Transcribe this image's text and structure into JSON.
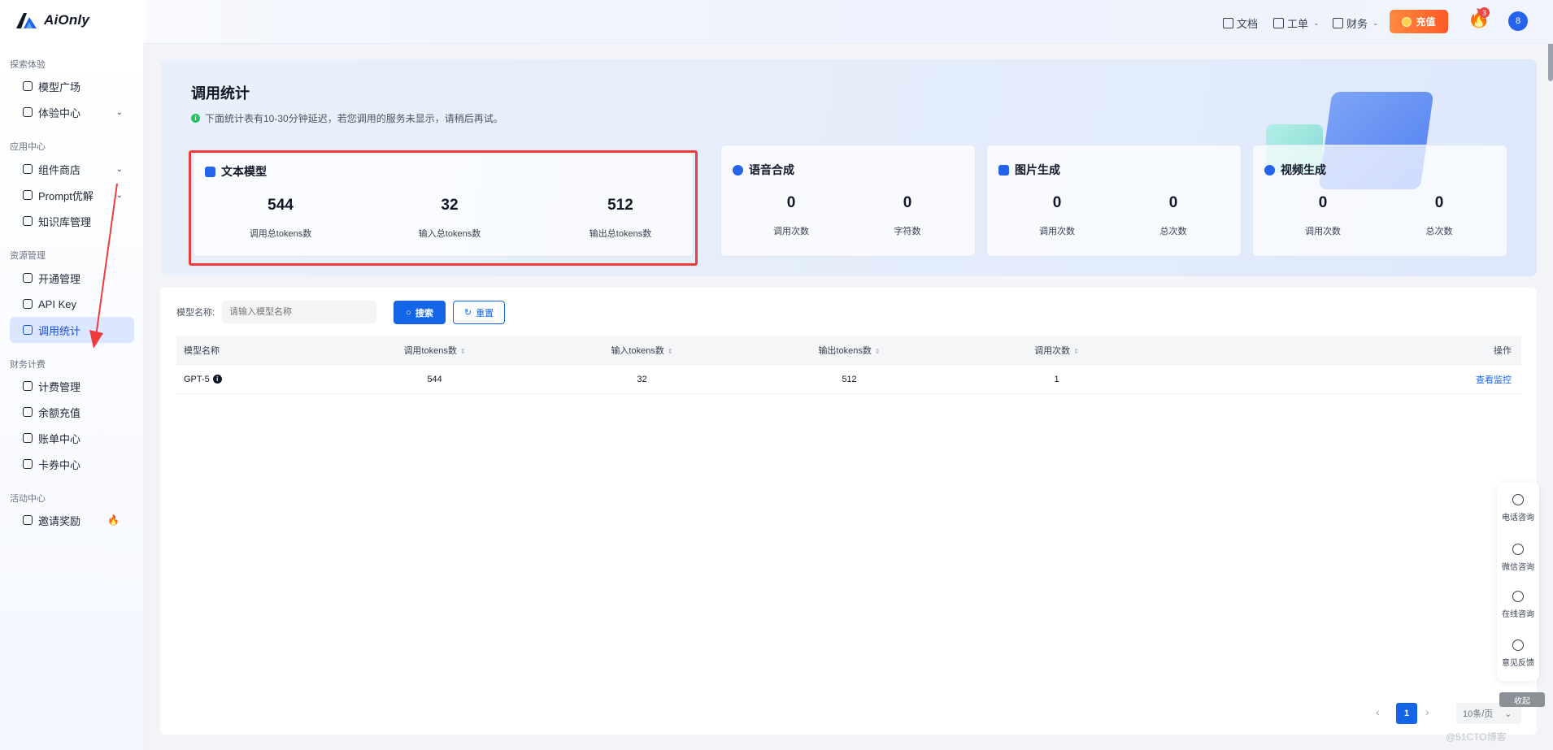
{
  "app": {
    "logo_text": "AiOnly"
  },
  "topnav": {
    "docs_label": "文档",
    "ticket_label": "工单",
    "finance_label": "财务",
    "recharge_label": "充值",
    "fire_badge": "3",
    "avatar_text": "8"
  },
  "sidebar": {
    "groups": [
      "探索体验",
      "应用中心",
      "资源管理",
      "财务计费",
      "活动中心"
    ],
    "items": [
      {
        "label": "模型广场"
      },
      {
        "label": "体验中心"
      },
      {
        "label": "组件商店"
      },
      {
        "label": "Prompt优解"
      },
      {
        "label": "知识库管理"
      },
      {
        "label": "开通管理"
      },
      {
        "label": "API Key"
      },
      {
        "label": "调用统计"
      },
      {
        "label": "计费管理"
      },
      {
        "label": "余额充值"
      },
      {
        "label": "账单中心"
      },
      {
        "label": "卡券中心"
      },
      {
        "label": "邀请奖励"
      }
    ],
    "active_item": "调用统计"
  },
  "hero": {
    "title": "调用统计",
    "note": "下面统计表有10-30分钟延迟，若您调用的服务未显示，请稍后再试。"
  },
  "stats": [
    {
      "title": "文本模型",
      "metrics": [
        {
          "value": "544",
          "label": "调用总tokens数"
        },
        {
          "value": "32",
          "label": "输入总tokens数"
        },
        {
          "value": "512",
          "label": "输出总tokens数"
        }
      ]
    },
    {
      "title": "语音合成",
      "metrics": [
        {
          "value": "0",
          "label": "调用次数"
        },
        {
          "value": "0",
          "label": "字符数"
        }
      ]
    },
    {
      "title": "图片生成",
      "metrics": [
        {
          "value": "0",
          "label": "调用次数"
        },
        {
          "value": "0",
          "label": "总次数"
        }
      ]
    },
    {
      "title": "视频生成",
      "metrics": [
        {
          "value": "0",
          "label": "调用次数"
        },
        {
          "value": "0",
          "label": "总次数"
        }
      ]
    }
  ],
  "filter": {
    "label": "模型名称:",
    "placeholder": "请输入模型名称",
    "search_label": "搜索",
    "reset_label": "重置"
  },
  "table": {
    "headers": [
      "模型名称",
      "调用tokens数",
      "输入tokens数",
      "输出tokens数",
      "调用次数",
      "操作"
    ],
    "rows": [
      {
        "model": "GPT-5",
        "call_tokens": "544",
        "input_tokens": "32",
        "output_tokens": "512",
        "calls": "1",
        "action": "查看监控"
      }
    ]
  },
  "pagination": {
    "current": "1",
    "page_size": "10条/页"
  },
  "support": {
    "items": [
      {
        "label": "电话咨询"
      },
      {
        "label": "微信咨询"
      },
      {
        "label": "在线咨询"
      },
      {
        "label": "意见反馈"
      }
    ],
    "collapse_label": "收起"
  },
  "watermark": "@51CTO博客",
  "colors": {
    "primary": "#1565e8",
    "highlight": "#ef3b3b",
    "recharge": "#ff6a2c"
  }
}
